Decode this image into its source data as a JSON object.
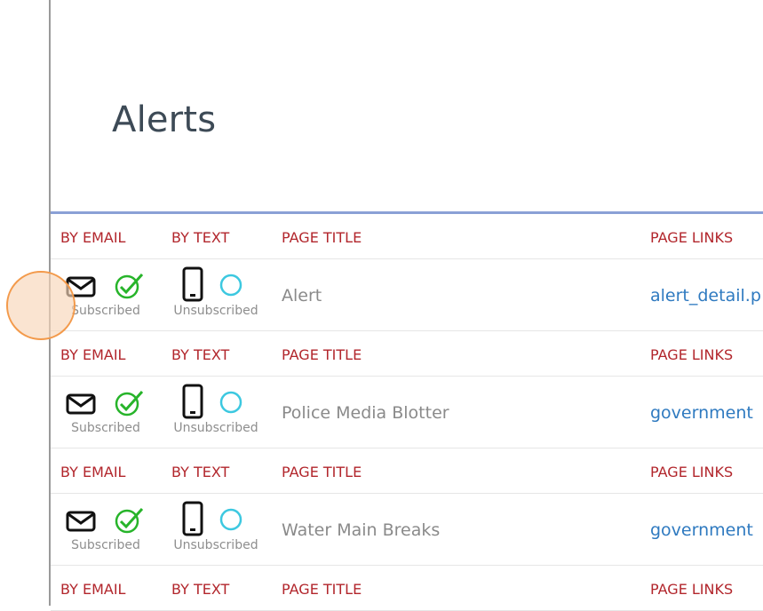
{
  "page": {
    "title": "Alerts"
  },
  "columns": {
    "by_email": "BY EMAIL",
    "by_text": "BY TEXT",
    "page_title": "PAGE TITLE",
    "page_links": "PAGE LINKS"
  },
  "rows": [
    {
      "email_status": "Subscribed",
      "text_status": "Unsubscribed",
      "page_title": "Alert",
      "page_link": "alert_detail.p"
    },
    {
      "email_status": "Subscribed",
      "text_status": "Unsubscribed",
      "page_title": "Police Media Blotter",
      "page_link": "government"
    },
    {
      "email_status": "Subscribed",
      "text_status": "Unsubscribed",
      "page_title": "Water Main Breaks",
      "page_link": "government"
    }
  ],
  "icons": {
    "email": "envelope-icon",
    "subscribed": "check-circle-icon",
    "text": "mobile-phone-icon",
    "unsubscribed": "empty-circle-icon"
  },
  "colors": {
    "header_text": "#b2262c",
    "rule": "#8aa0d6",
    "link": "#2f7ac0",
    "check": "#27b42a",
    "circle": "#3cc8e0"
  }
}
